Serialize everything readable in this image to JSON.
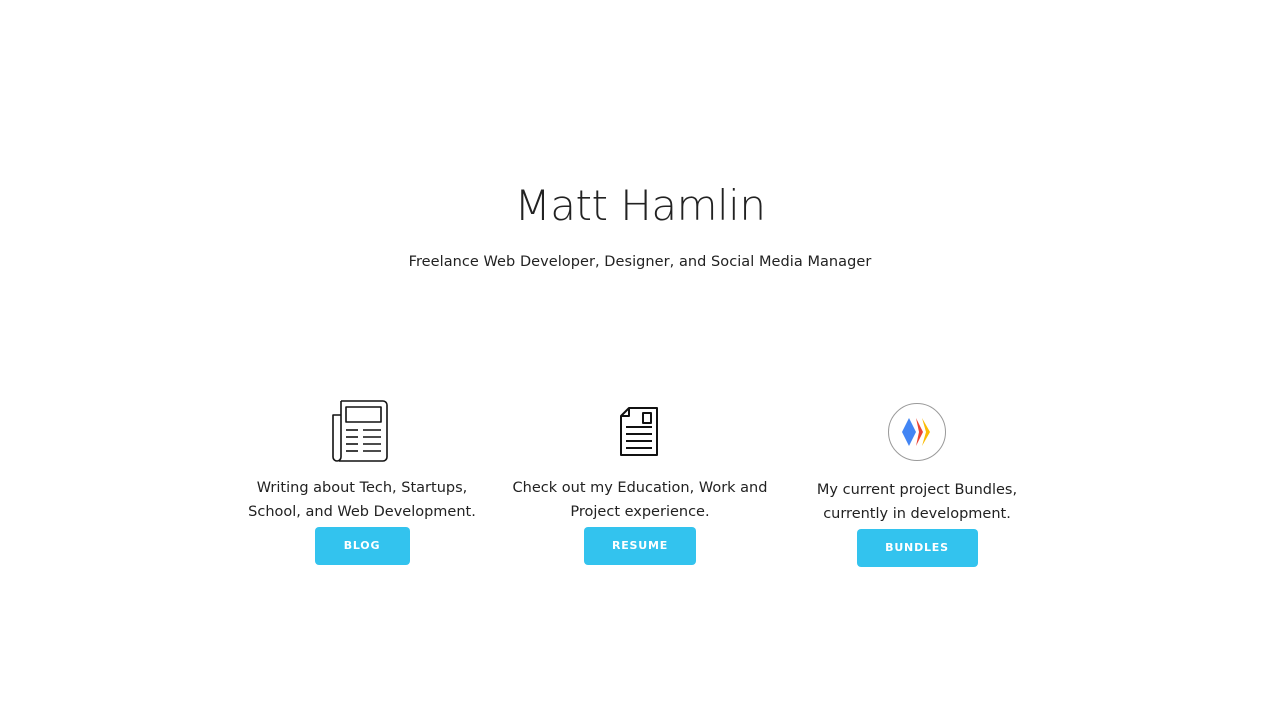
{
  "header": {
    "name": "Matt Hamlin",
    "tagline": "Freelance Web Developer, Designer, and Social Media Manager"
  },
  "sections": [
    {
      "icon": "newspaper-icon",
      "description": "Writing about Tech, Startups, School, and Web Development.",
      "button_label": "BLOG"
    },
    {
      "icon": "document-icon",
      "description": "Check out my Education, Work and Project experience.",
      "button_label": "RESUME"
    },
    {
      "icon": "bundles-logo-icon",
      "description": "My current project Bundles, currently in development.",
      "button_label": "BUNDLES"
    }
  ],
  "colors": {
    "accent": "#33c3ee",
    "text": "#222222",
    "background": "#ffffff",
    "bundles_blue": "#4285f4",
    "bundles_red": "#ea4335",
    "bundles_yellow": "#fbbc05"
  }
}
